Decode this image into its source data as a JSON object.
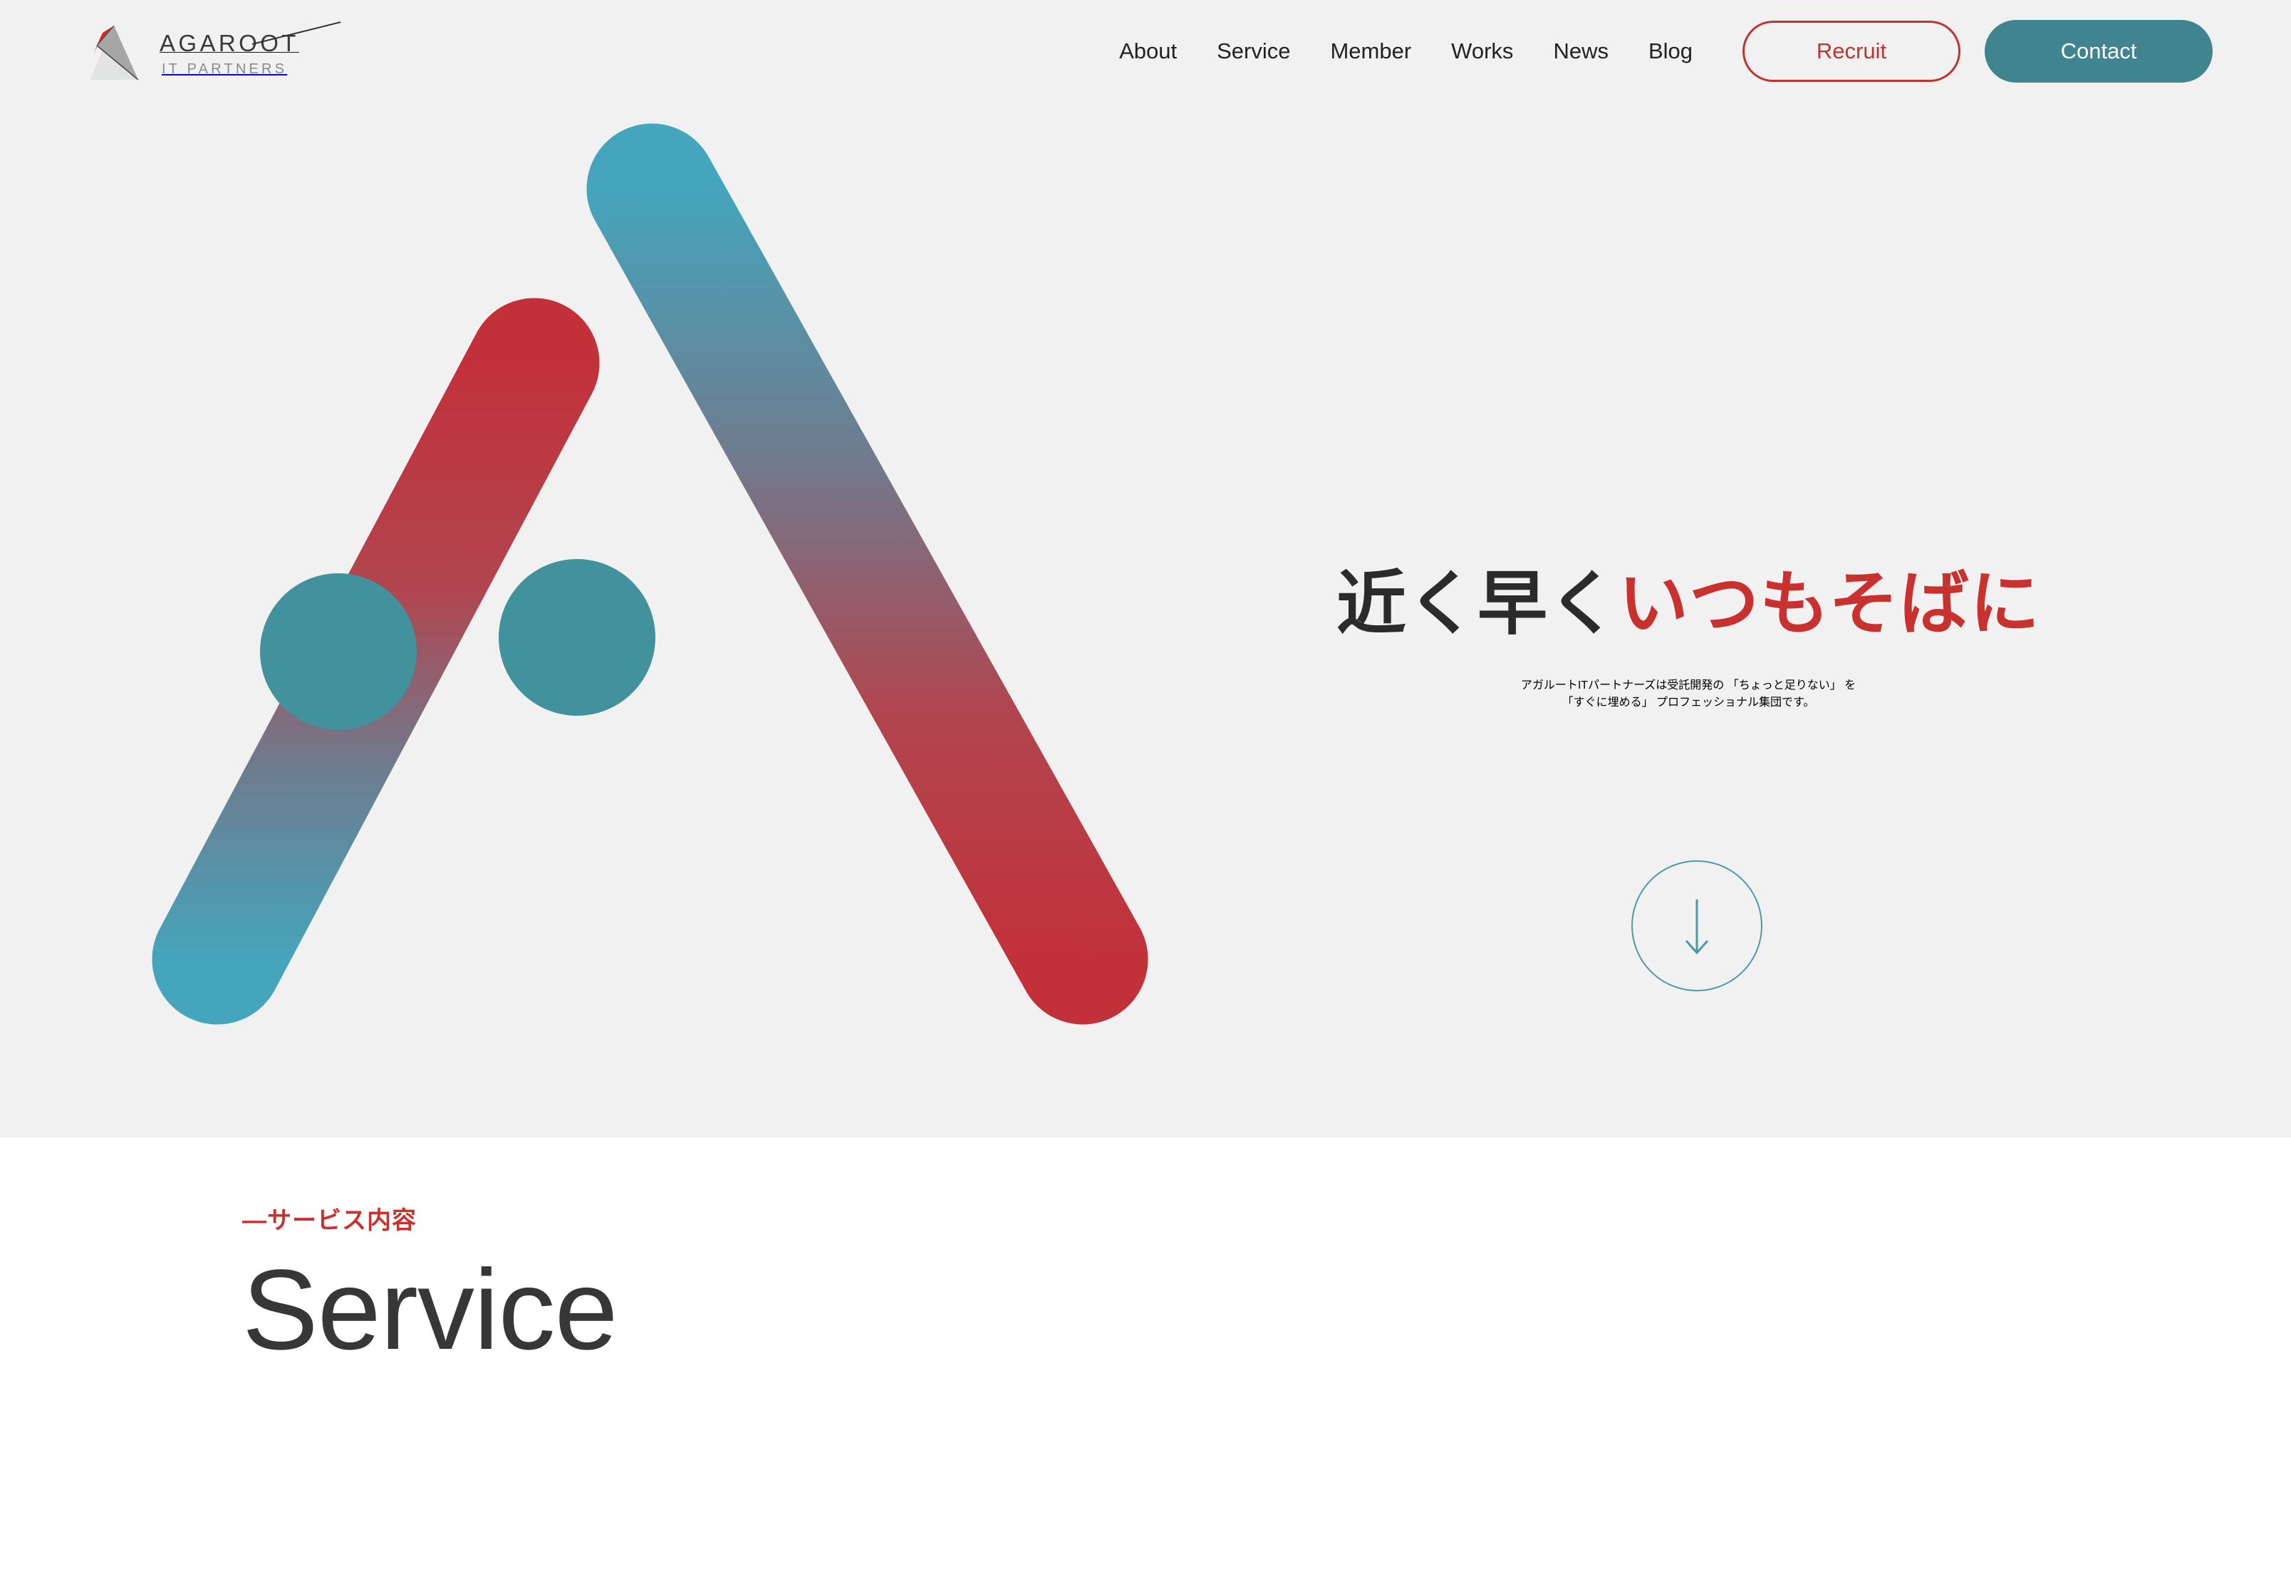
{
  "header": {
    "logo": {
      "wordmark": "AGAROOT",
      "subtitle": "IT PARTNERS",
      "mark_icon": "agaroot-triangle-logo-icon",
      "colors": {
        "red": "#D32B26",
        "gray": "#A6A6A6",
        "light_gray": "#E2E4E3"
      }
    },
    "nav": [
      {
        "label": "About"
      },
      {
        "label": "Service"
      },
      {
        "label": "Member"
      },
      {
        "label": "Works"
      },
      {
        "label": "News"
      },
      {
        "label": "Blog"
      }
    ],
    "recruit_button": {
      "label": "Recruit",
      "border_color": "#C0332F",
      "text_color": "#C0332F"
    },
    "contact_button": {
      "label": "Contact",
      "background": "#40848F",
      "text_color": "#FFFFFF"
    }
  },
  "hero": {
    "background": "#F2F1F1",
    "title": {
      "dark_part": "近く早く",
      "red_part": "いつもそばに",
      "dark_color": "#2B2B2B",
      "red_color": "#C8312E"
    },
    "lead": {
      "line1": "アガルートITパートナーズは受託開発の 「ちょっと足りない」 を",
      "line2": "「すぐに埋める」 プロフェッショナル集団です。"
    },
    "scroll_down": {
      "icon": "arrow-down-icon",
      "color": "#4A9AA8"
    },
    "graphic": {
      "name": "triangle-logo-graphic",
      "teal": "#44A5BC",
      "red": "#C2313A",
      "circle_teal": "#42929E",
      "bars": [
        {
          "name": "left-bar",
          "gradient_from": "#C2313A",
          "gradient_to": "#44A5BC"
        },
        {
          "name": "right-bar",
          "gradient_from": "#44A5BC",
          "gradient_to": "#C2313A"
        },
        {
          "name": "bottom-bar",
          "gradient_from": "#C2313A",
          "gradient_to": "#44A5BC"
        }
      ],
      "circles": [
        {
          "name": "left-circle"
        },
        {
          "name": "right-circle"
        }
      ]
    }
  },
  "service": {
    "background": "#FFFFFF",
    "eyebrow": "—サービス内容",
    "eyebrow_color": "#C8312E",
    "title": "Service",
    "title_color": "#373737"
  }
}
